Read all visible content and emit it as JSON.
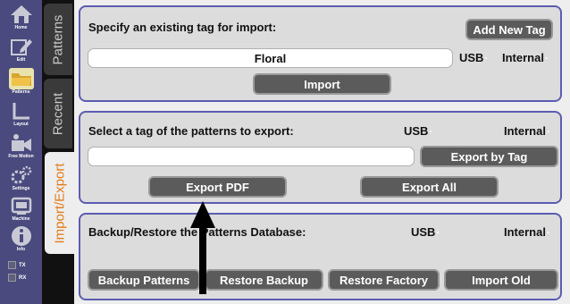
{
  "nav": {
    "items": [
      {
        "label": "Home",
        "icon": "home-icon"
      },
      {
        "label": "Edit",
        "icon": "edit-icon"
      },
      {
        "label": "Patterns",
        "icon": "folder-icon"
      },
      {
        "label": "Layout",
        "icon": "layout-icon"
      },
      {
        "label": "Free Motion",
        "icon": "free-motion-icon"
      },
      {
        "label": "Settings",
        "icon": "gears-icon"
      },
      {
        "label": "Machine",
        "icon": "machine-icon"
      },
      {
        "label": "Info",
        "icon": "info-icon"
      }
    ],
    "tx": "TX",
    "rx": "RX"
  },
  "tabs": {
    "patterns": "Patterns",
    "recent": "Recent",
    "import_export": "Import/Export"
  },
  "import": {
    "title": "Specify an existing tag for import:",
    "add_tag_label": "Add New Tag",
    "tag_value": "Floral",
    "usb_label": "USB",
    "internal_label": "Internal",
    "import_label": "Import"
  },
  "export": {
    "title": "Select a tag of the patterns to export:",
    "usb_label": "USB",
    "internal_label": "Internal",
    "tag_value": "",
    "export_by_tag_label": "Export by Tag",
    "export_pdf_label": "Export PDF",
    "export_all_label": "Export All"
  },
  "backup": {
    "title": "Backup/Restore the Patterns Database:",
    "usb_label": "USB",
    "internal_label": "Internal",
    "buttons": [
      "Backup Patterns",
      "Restore Backup",
      "Restore Factory",
      "Import Old"
    ]
  },
  "colors": {
    "rail": "#4a4a7e",
    "panel_border": "#5c5cb0",
    "active_tab_text": "#e27b18",
    "button": "#5b5b5b"
  }
}
